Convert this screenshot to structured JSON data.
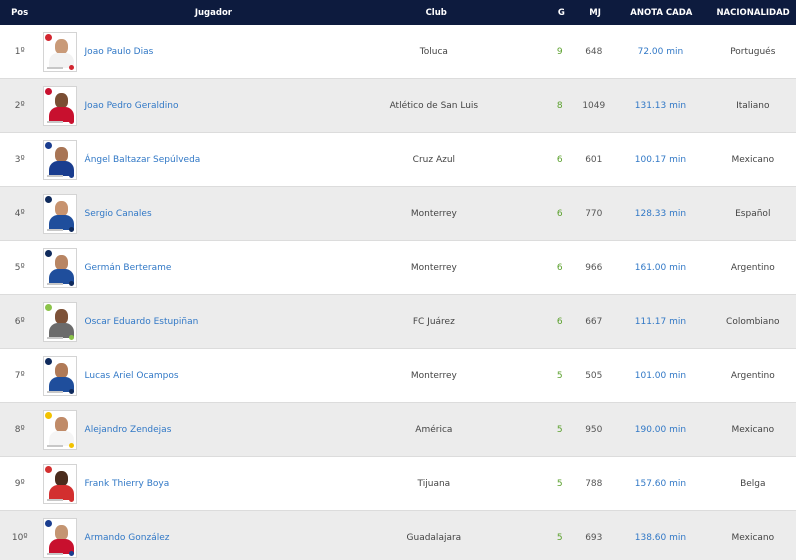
{
  "header": {
    "pos": "Pos",
    "player": "Jugador",
    "club": "Club",
    "goals": "G",
    "matches": "MJ",
    "scores_every": "ANOTA CADA",
    "nationality": "NACIONALIDAD"
  },
  "rows": [
    {
      "pos": "1º",
      "name": "Joao Paulo Dias",
      "club": "Toluca",
      "goals": "9",
      "matches": "648",
      "scores_every": "72.00 min",
      "nationality": "Portugués",
      "kit": "#f2f2f2",
      "skin": "#c99a78",
      "badge": "#d22630"
    },
    {
      "pos": "2º",
      "name": "Joao Pedro Geraldino",
      "club": "Atlético de San Luis",
      "goals": "8",
      "matches": "1049",
      "scores_every": "131.13 min",
      "nationality": "Italiano",
      "kit": "#c8102e",
      "skin": "#7a4e33",
      "badge": "#c8102e"
    },
    {
      "pos": "3º",
      "name": "Ángel Baltazar Sepúlveda",
      "club": "Cruz Azul",
      "goals": "6",
      "matches": "601",
      "scores_every": "100.17 min",
      "nationality": "Mexicano",
      "kit": "#1a3d8f",
      "skin": "#a87555",
      "badge": "#1a3d8f"
    },
    {
      "pos": "4º",
      "name": "Sergio Canales",
      "club": "Monterrey",
      "goals": "6",
      "matches": "770",
      "scores_every": "128.33 min",
      "nationality": "Español",
      "kit": "#1f4e9c",
      "skin": "#c7936f",
      "badge": "#0f2a5c"
    },
    {
      "pos": "5º",
      "name": "Germán Berterame",
      "club": "Monterrey",
      "goals": "6",
      "matches": "966",
      "scores_every": "161.00 min",
      "nationality": "Argentino",
      "kit": "#1f4e9c",
      "skin": "#b88563",
      "badge": "#0f2a5c"
    },
    {
      "pos": "6º",
      "name": "Oscar Eduardo Estupiñan",
      "club": "FC Juárez",
      "goals": "6",
      "matches": "667",
      "scores_every": "111.17 min",
      "nationality": "Colombiano",
      "kit": "#6b6b6b",
      "skin": "#7d5238",
      "badge": "#8bc34a"
    },
    {
      "pos": "7º",
      "name": "Lucas Ariel Ocampos",
      "club": "Monterrey",
      "goals": "5",
      "matches": "505",
      "scores_every": "101.00 min",
      "nationality": "Argentino",
      "kit": "#1f4e9c",
      "skin": "#b07a57",
      "badge": "#0f2a5c"
    },
    {
      "pos": "8º",
      "name": "Alejandro Zendejas",
      "club": "América",
      "goals": "5",
      "matches": "950",
      "scores_every": "190.00 min",
      "nationality": "Mexicano",
      "kit": "#f5f5f5",
      "skin": "#c08b68",
      "badge": "#f2c200"
    },
    {
      "pos": "9º",
      "name": "Frank Thierry Boya",
      "club": "Tijuana",
      "goals": "5",
      "matches": "788",
      "scores_every": "157.60 min",
      "nationality": "Belga",
      "kit": "#d32f2f",
      "skin": "#4a2c1d",
      "badge": "#d32f2f"
    },
    {
      "pos": "10º",
      "name": "Armando González",
      "club": "Guadalajara",
      "goals": "5",
      "matches": "693",
      "scores_every": "138.60 min",
      "nationality": "Mexicano",
      "kit": "#c8102e",
      "skin": "#c49572",
      "badge": "#1a3d8f"
    }
  ]
}
